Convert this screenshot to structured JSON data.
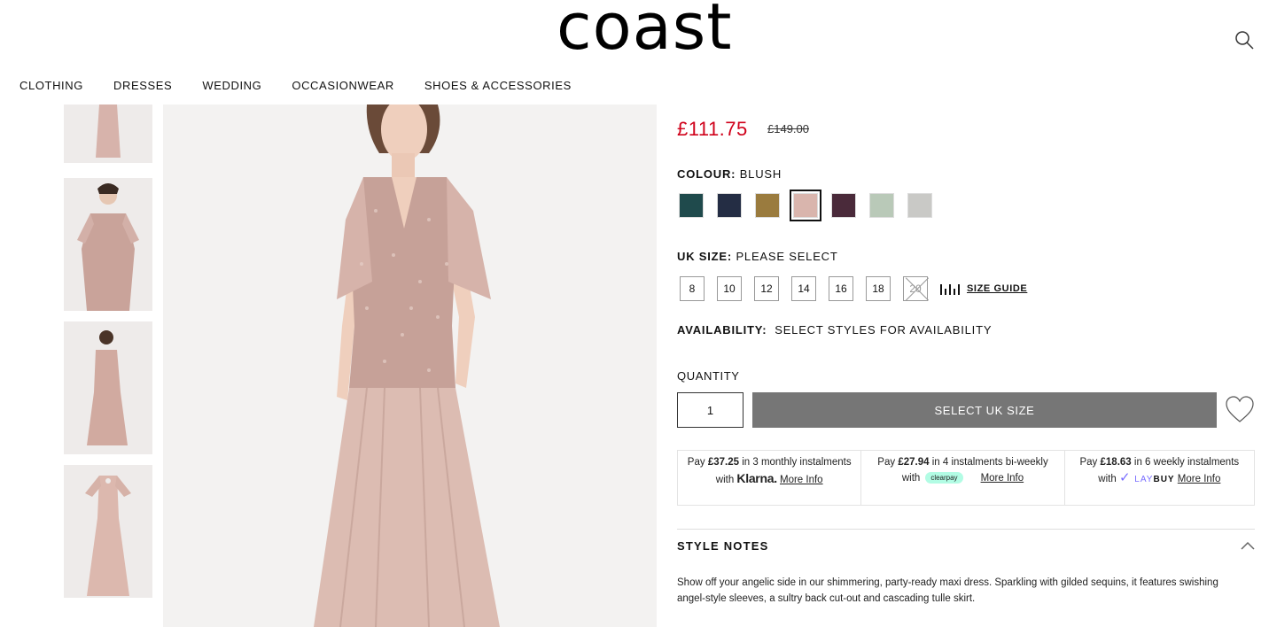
{
  "brand": {
    "logo": "coast"
  },
  "nav": [
    "CLOTHING",
    "DRESSES",
    "WEDDING",
    "OCCASIONWEAR",
    "SHOES & ACCESSORIES"
  ],
  "product": {
    "price": "£111.75",
    "was_price": "£149.00",
    "colour_label": "COLOUR:",
    "colour_value": "BLUSH",
    "swatches": [
      {
        "name": "teal",
        "color": "#1f4a4c"
      },
      {
        "name": "navy",
        "color": "#242d44"
      },
      {
        "name": "gold",
        "color": "#9a7b3e"
      },
      {
        "name": "blush",
        "color": "#d9b5ad",
        "selected": true
      },
      {
        "name": "plum",
        "color": "#4a2a3a"
      },
      {
        "name": "sage",
        "color": "#b9c9b8"
      },
      {
        "name": "silver",
        "color": "#c9c9c6"
      }
    ],
    "size_label": "UK SIZE:",
    "size_value": "PLEASE SELECT",
    "sizes": [
      {
        "label": "8",
        "available": true
      },
      {
        "label": "10",
        "available": true
      },
      {
        "label": "12",
        "available": true
      },
      {
        "label": "14",
        "available": true
      },
      {
        "label": "16",
        "available": true
      },
      {
        "label": "18",
        "available": true
      },
      {
        "label": "20",
        "available": false
      }
    ],
    "size_guide": "SIZE GUIDE",
    "availability_label": "AVAILABILITY:",
    "availability_value": "SELECT STYLES FOR AVAILABILITY",
    "quantity_label": "QUANTITY",
    "quantity": "1",
    "add_button": "SELECT UK SIZE"
  },
  "payments": {
    "klarna": {
      "pay": "Pay",
      "amount": "£37.25",
      "text": "in 3 monthly instalments with",
      "brand": "Klarna.",
      "link": "More Info"
    },
    "clearpay": {
      "pay": "Pay",
      "amount": "£27.94",
      "text": "in 4 instalments bi-weekly",
      "with": "with",
      "brand": "clearpay",
      "link": "More Info"
    },
    "laybuy": {
      "pay": "Pay",
      "amount": "£18.63",
      "text": "in 6 weekly instalments",
      "with": "with",
      "brand_a": "LAY",
      "brand_b": "BUY",
      "link": "More Info"
    }
  },
  "style_notes": {
    "title": "STYLE NOTES",
    "text": "Show off your angelic side in our shimmering, party-ready maxi dress. Sparkling with gilded sequins, it features swishing angel-style sleeves, a sultry back cut-out and cascading tulle skirt."
  }
}
